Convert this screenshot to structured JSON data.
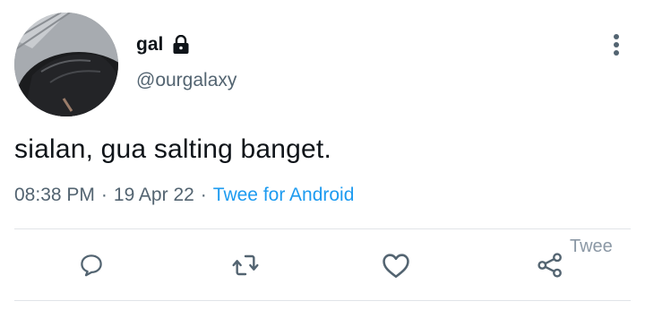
{
  "user": {
    "display_name": "gal",
    "handle": "@ourgalaxy",
    "avatar_icon": "user-avatar-photo",
    "protected_icon": "lock-icon"
  },
  "tweet": {
    "text": "sialan, gua salting banget.",
    "time": "08:38 PM",
    "date": "19 Apr 22",
    "separator": "·",
    "source": "Twee for Android"
  },
  "actions": {
    "reply_icon": "reply-icon",
    "retweet_icon": "retweet-icon",
    "like_icon": "like-icon",
    "share_icon": "share-icon",
    "share_label": "Twee"
  },
  "colors": {
    "text": "#0f1419",
    "secondary": "#536471",
    "link": "#1d9bf0",
    "icon": "#536471"
  }
}
